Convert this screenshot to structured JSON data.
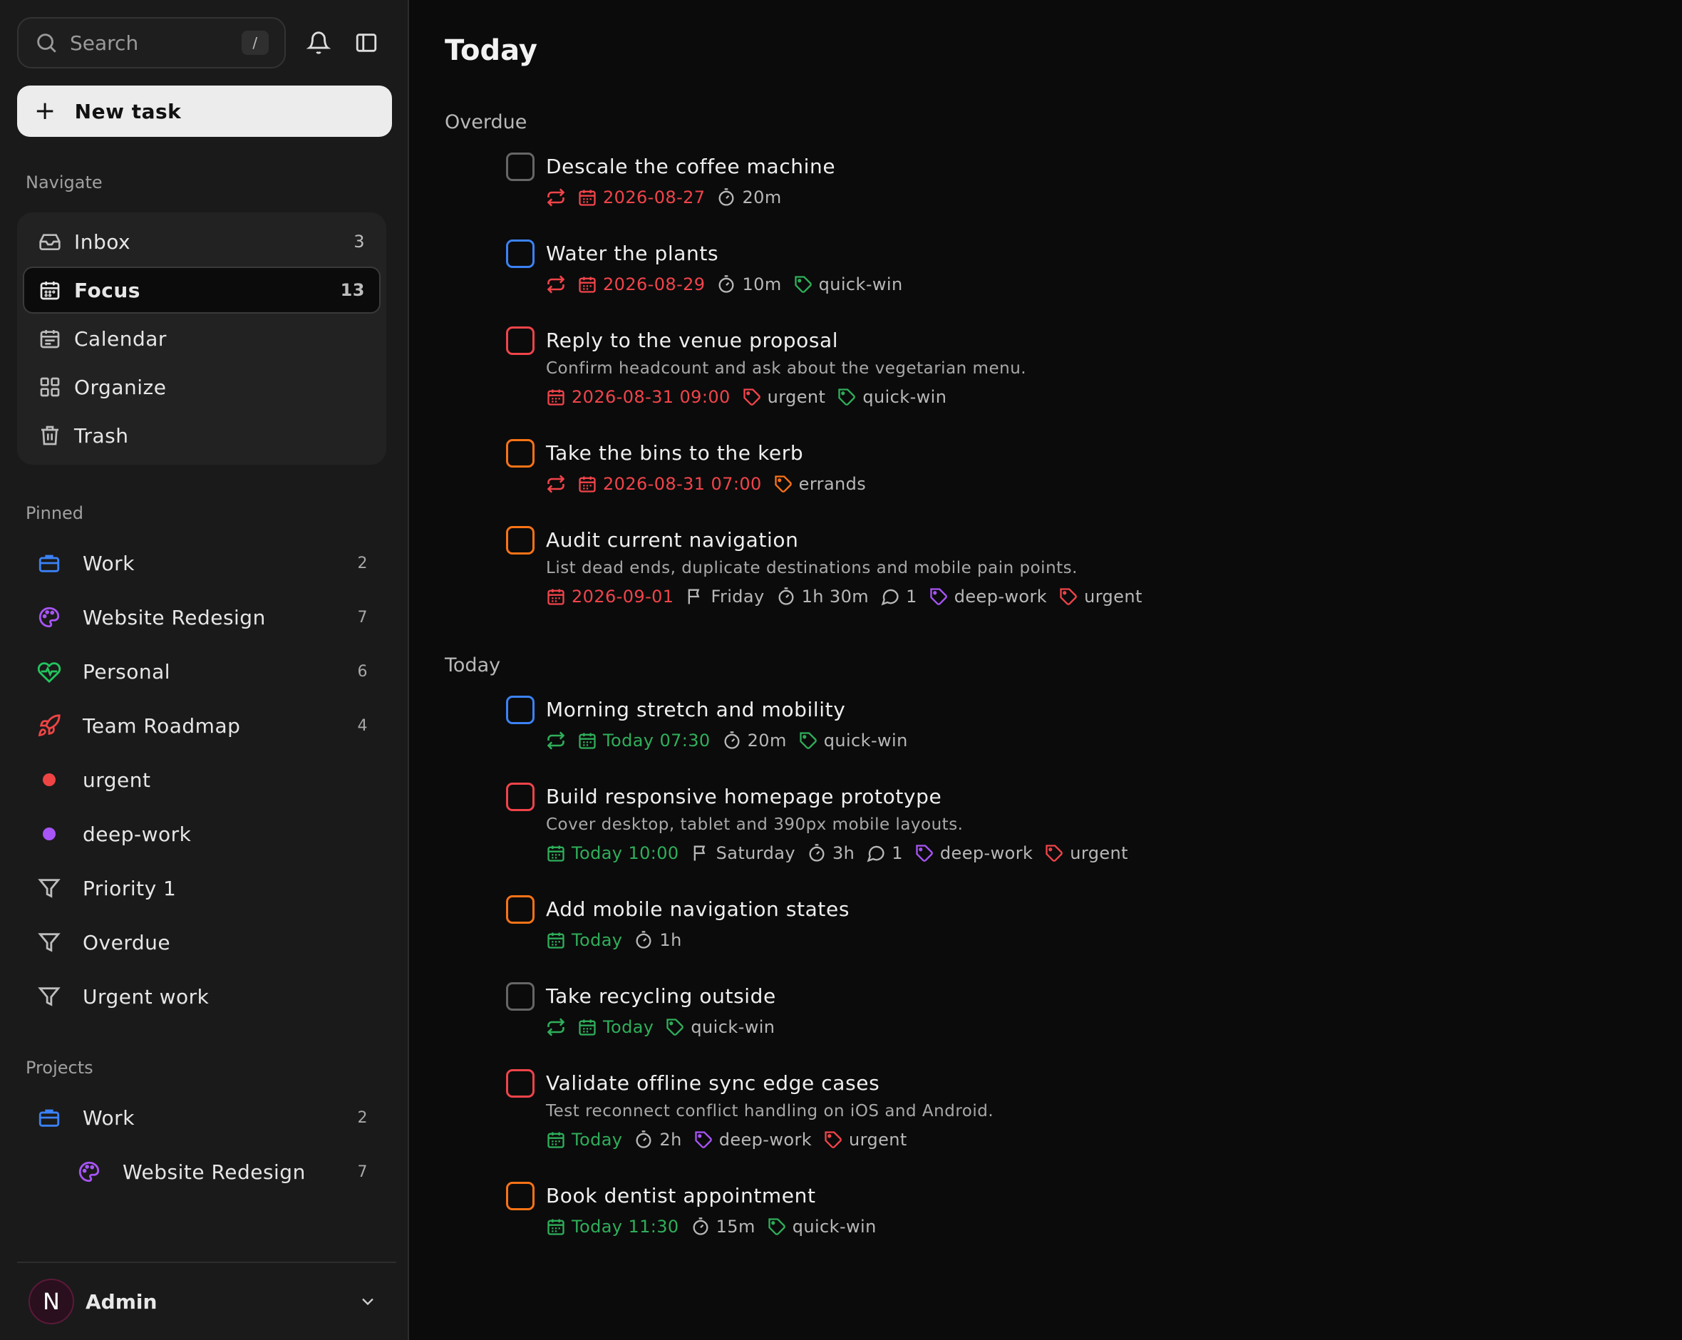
{
  "colors": {
    "priority1": "#f0444a",
    "priority2": "#f97316",
    "priority3": "#3b82f6",
    "none": "#666666",
    "overdue": "#f0444a",
    "today": "#2fae5a",
    "tag_urgent": "#f0444a",
    "tag_quickwin": "#2fae5a",
    "tag_deepwork": "#a855f7",
    "tag_errands": "#f97316"
  },
  "sidebar": {
    "search_placeholder": "Search",
    "search_shortcut": "/",
    "new_task_label": "New task",
    "navigate_label": "Navigate",
    "nav": [
      {
        "label": "Inbox",
        "count": "3",
        "icon": "inbox-icon"
      },
      {
        "label": "Focus",
        "count": "13",
        "icon": "calendar-icon"
      },
      {
        "label": "Calendar",
        "count": "",
        "icon": "calendar-grid-icon"
      },
      {
        "label": "Organize",
        "count": "",
        "icon": "grid-icon"
      },
      {
        "label": "Trash",
        "count": "",
        "icon": "trash-icon"
      }
    ],
    "pinned_label": "Pinned",
    "pinned": [
      {
        "label": "Work",
        "count": "2",
        "icon": "briefcase-icon",
        "color": "#3b82f6"
      },
      {
        "label": "Website Redesign",
        "count": "7",
        "icon": "palette-icon",
        "color": "#a855f7"
      },
      {
        "label": "Personal",
        "count": "6",
        "icon": "heart-pulse-icon",
        "color": "#22c55e"
      },
      {
        "label": "Team Roadmap",
        "count": "4",
        "icon": "rocket-icon",
        "color": "#ef4444"
      },
      {
        "label": "urgent",
        "count": "",
        "icon": "dot-icon",
        "color": "#ef4444"
      },
      {
        "label": "deep-work",
        "count": "",
        "icon": "dot-icon",
        "color": "#a855f7"
      },
      {
        "label": "Priority 1",
        "count": "",
        "icon": "filter-icon",
        "color": "#bdbdbd"
      },
      {
        "label": "Overdue",
        "count": "",
        "icon": "filter-icon",
        "color": "#bdbdbd"
      },
      {
        "label": "Urgent work",
        "count": "",
        "icon": "filter-icon",
        "color": "#bdbdbd"
      }
    ],
    "projects_label": "Projects",
    "projects": [
      {
        "label": "Work",
        "count": "2",
        "icon": "briefcase-icon",
        "color": "#3b82f6"
      },
      {
        "label": "Website Redesign",
        "count": "7",
        "icon": "palette-icon",
        "color": "#a855f7"
      }
    ],
    "user": {
      "initial": "N",
      "name": "Admin"
    }
  },
  "main": {
    "title": "Today",
    "groups": [
      {
        "label": "Overdue",
        "tasks": [
          {
            "title": "Descale the coffee machine",
            "priority": "none",
            "desc": "",
            "repeat": true,
            "date": "2026-08-27",
            "date_color": "overdue",
            "deadline": "",
            "duration": "20m",
            "comments": "",
            "tags": []
          },
          {
            "title": "Water the plants",
            "priority": "priority3",
            "desc": "",
            "repeat": true,
            "date": "2026-08-29",
            "date_color": "overdue",
            "deadline": "",
            "duration": "10m",
            "comments": "",
            "tags": [
              {
                "name": "quick-win",
                "color": "tag_quickwin"
              }
            ]
          },
          {
            "title": "Reply to the venue proposal",
            "priority": "priority1",
            "desc": "Confirm headcount and ask about the vegetarian menu.",
            "repeat": false,
            "date": "2026-08-31 09:00",
            "date_color": "overdue",
            "deadline": "",
            "duration": "",
            "comments": "",
            "tags": [
              {
                "name": "urgent",
                "color": "tag_urgent"
              },
              {
                "name": "quick-win",
                "color": "tag_quickwin"
              }
            ]
          },
          {
            "title": "Take the bins to the kerb",
            "priority": "priority2",
            "desc": "",
            "repeat": true,
            "date": "2026-08-31 07:00",
            "date_color": "overdue",
            "deadline": "",
            "duration": "",
            "comments": "",
            "tags": [
              {
                "name": "errands",
                "color": "tag_errands"
              }
            ]
          },
          {
            "title": "Audit current navigation",
            "priority": "priority2",
            "desc": "List dead ends, duplicate destinations and mobile pain points.",
            "repeat": false,
            "date": "2026-09-01",
            "date_color": "overdue",
            "deadline": "Friday",
            "duration": "1h 30m",
            "comments": "1",
            "tags": [
              {
                "name": "deep-work",
                "color": "tag_deepwork"
              },
              {
                "name": "urgent",
                "color": "tag_urgent"
              }
            ]
          }
        ]
      },
      {
        "label": "Today",
        "tasks": [
          {
            "title": "Morning stretch and mobility",
            "priority": "priority3",
            "desc": "",
            "repeat": true,
            "date": "Today 07:30",
            "date_color": "today",
            "deadline": "",
            "duration": "20m",
            "comments": "",
            "tags": [
              {
                "name": "quick-win",
                "color": "tag_quickwin"
              }
            ]
          },
          {
            "title": "Build responsive homepage prototype",
            "priority": "priority1",
            "desc": "Cover desktop, tablet and 390px mobile layouts.",
            "repeat": false,
            "date": "Today 10:00",
            "date_color": "today",
            "deadline": "Saturday",
            "duration": "3h",
            "comments": "1",
            "tags": [
              {
                "name": "deep-work",
                "color": "tag_deepwork"
              },
              {
                "name": "urgent",
                "color": "tag_urgent"
              }
            ]
          },
          {
            "title": "Add mobile navigation states",
            "priority": "priority2",
            "desc": "",
            "repeat": false,
            "date": "Today",
            "date_color": "today",
            "deadline": "",
            "duration": "1h",
            "comments": "",
            "tags": []
          },
          {
            "title": "Take recycling outside",
            "priority": "none",
            "desc": "",
            "repeat": true,
            "date": "Today",
            "date_color": "today",
            "deadline": "",
            "duration": "",
            "comments": "",
            "tags": [
              {
                "name": "quick-win",
                "color": "tag_quickwin"
              }
            ]
          },
          {
            "title": "Validate offline sync edge cases",
            "priority": "priority1",
            "desc": "Test reconnect conflict handling on iOS and Android.",
            "repeat": false,
            "date": "Today",
            "date_color": "today",
            "deadline": "",
            "duration": "2h",
            "comments": "",
            "tags": [
              {
                "name": "deep-work",
                "color": "tag_deepwork"
              },
              {
                "name": "urgent",
                "color": "tag_urgent"
              }
            ]
          },
          {
            "title": "Book dentist appointment",
            "priority": "priority2",
            "desc": "",
            "repeat": false,
            "date": "Today 11:30",
            "date_color": "today",
            "deadline": "",
            "duration": "15m",
            "comments": "",
            "tags": [
              {
                "name": "quick-win",
                "color": "tag_quickwin"
              }
            ]
          }
        ]
      }
    ]
  }
}
